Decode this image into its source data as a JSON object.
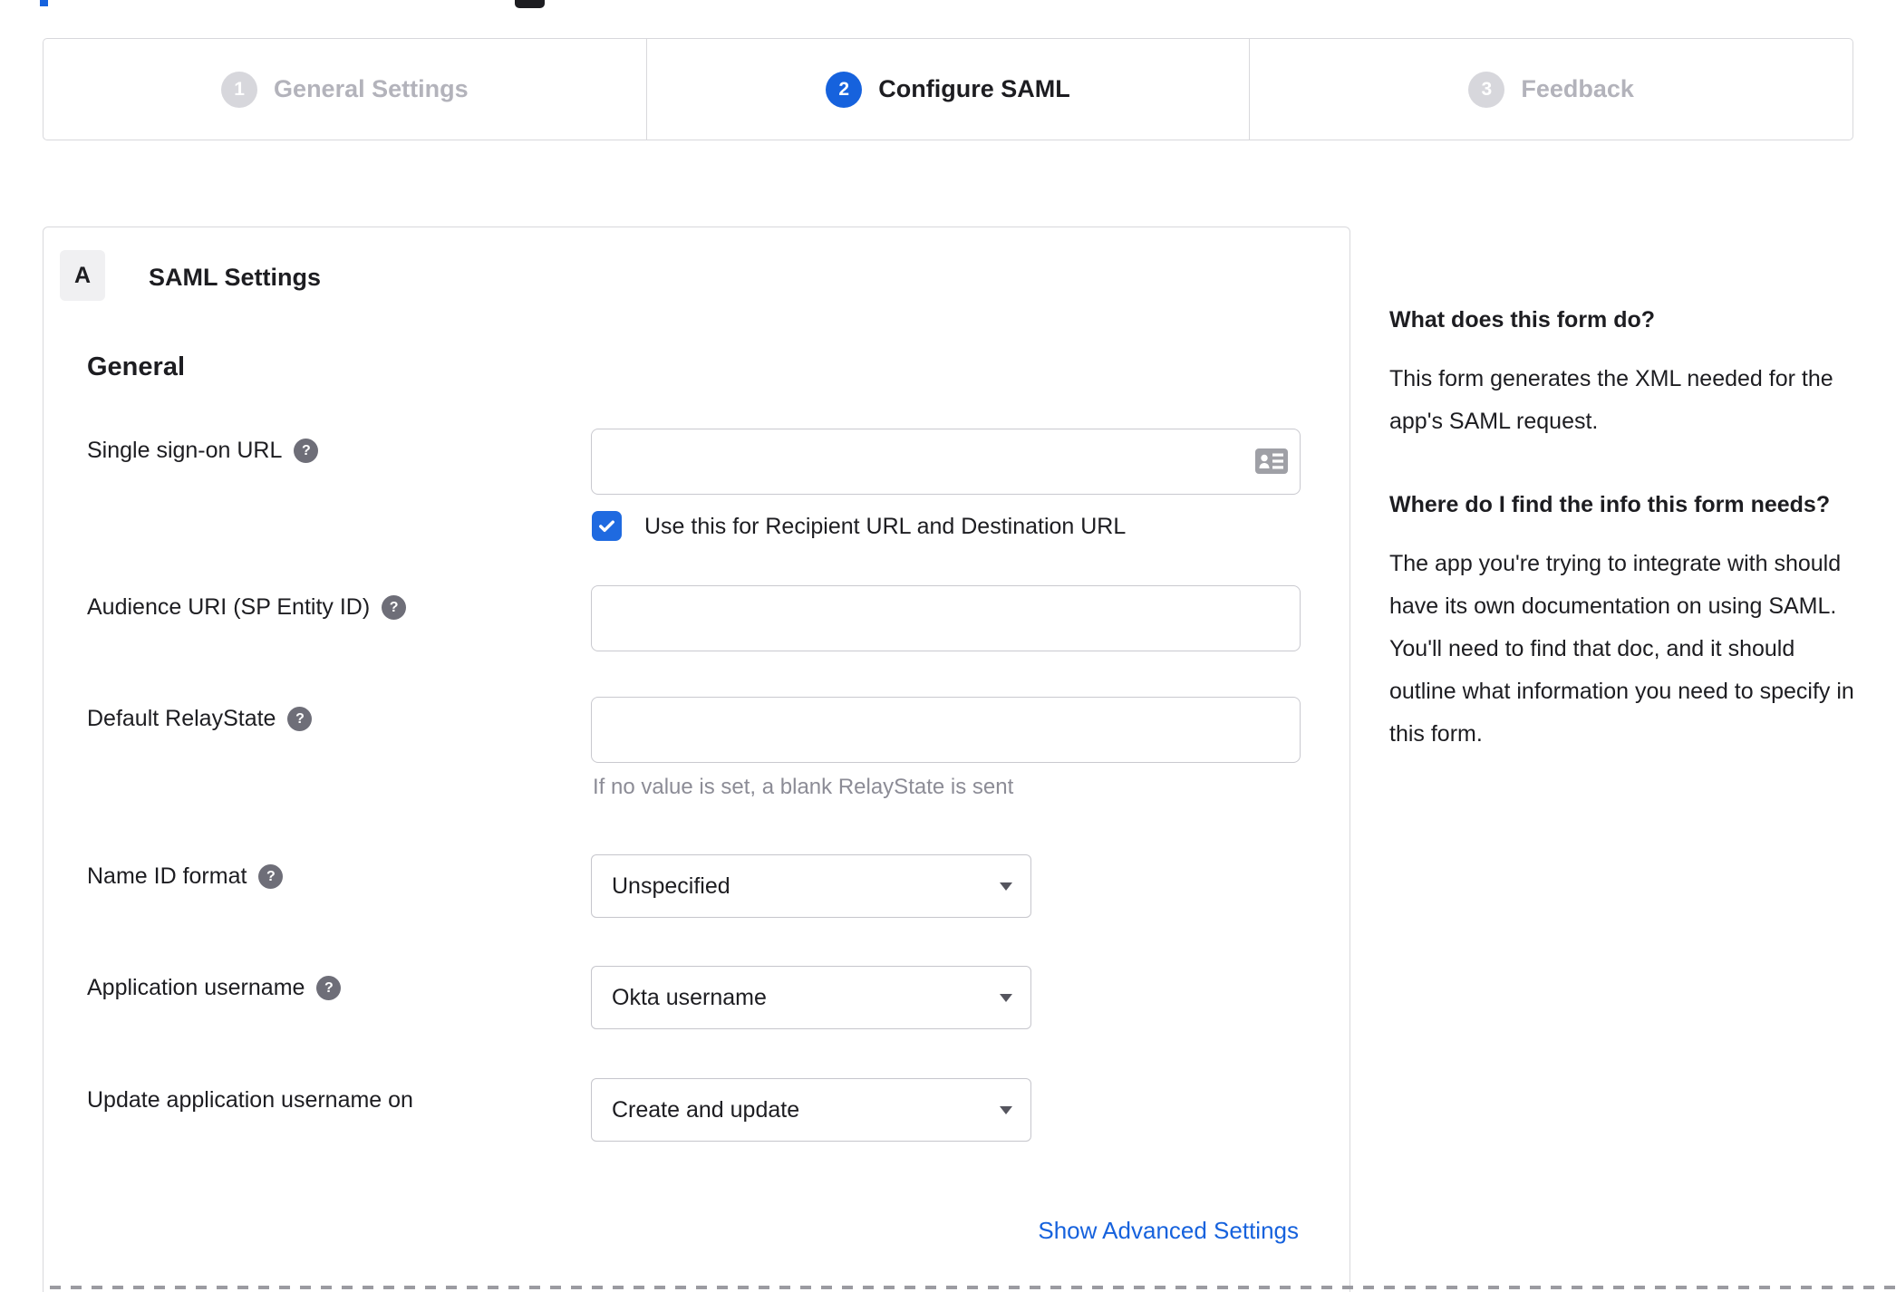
{
  "stepper": {
    "steps": [
      {
        "number": "1",
        "label": "General Settings",
        "state": "inactive"
      },
      {
        "number": "2",
        "label": "Configure SAML",
        "state": "active"
      },
      {
        "number": "3",
        "label": "Feedback",
        "state": "inactive"
      }
    ]
  },
  "panel": {
    "badge": "A",
    "title": "SAML Settings",
    "section": "General",
    "fields": {
      "sso": {
        "label": "Single sign-on URL",
        "value": "",
        "checkbox_label": "Use this for Recipient URL and Destination URL",
        "checkbox_checked": true
      },
      "audience": {
        "label": "Audience URI (SP Entity ID)",
        "value": ""
      },
      "relay": {
        "label": "Default RelayState",
        "value": "",
        "helper": "If no value is set, a blank RelayState is sent"
      },
      "name_id": {
        "label": "Name ID format",
        "value": "Unspecified"
      },
      "app_username": {
        "label": "Application username",
        "value": "Okta username"
      },
      "update_username": {
        "label": "Update application username on",
        "value": "Create and update"
      }
    },
    "advanced_link": "Show Advanced Settings"
  },
  "sidebar": {
    "sections": [
      {
        "heading": "What does this form do?",
        "body": "This form generates the XML needed for the app's SAML request."
      },
      {
        "heading": "Where do I find the info this form needs?",
        "body": "The app you're trying to integrate with should have its own documentation on using SAML. You'll need to find that doc, and it should outline what information you need to specify in this form."
      }
    ]
  },
  "colors": {
    "accent_blue": "#1662dd",
    "checkbox_blue": "#1f6ae0",
    "inactive_circle_gray": "#d7d7dc",
    "border_gray": "#d8d8dc",
    "help_icon_gray": "#6e6e78",
    "muted_text_gray": "#8c8c96"
  }
}
